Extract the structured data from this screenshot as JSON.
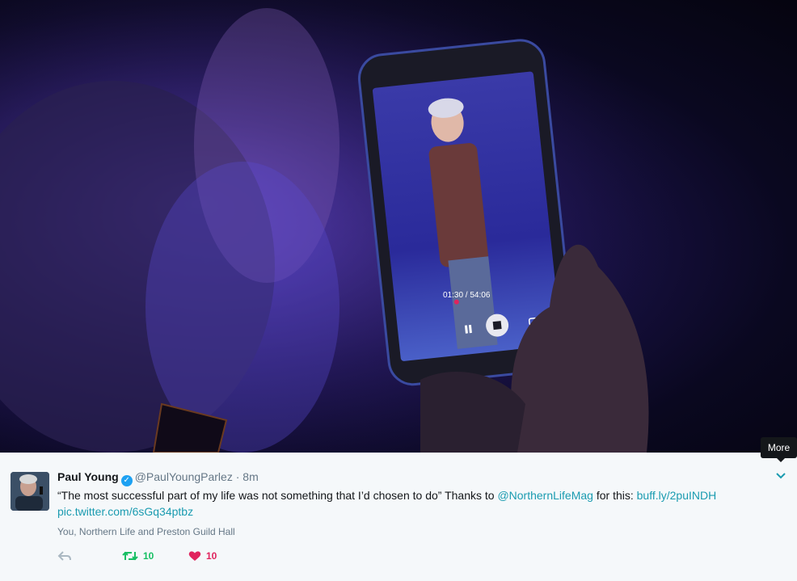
{
  "photo": {
    "alt": "",
    "phone_timer": "01:30 / 54:06"
  },
  "tweet": {
    "author_name": "Paul Young",
    "handle": "@PaulYoungParlez",
    "separator": "·",
    "time": "8m",
    "text_quote": "“The most successful part of my life was not something that I’d chosen to do” Thanks to ",
    "mention": "@NorthernLifeMag",
    "text_mid": " for this: ",
    "short_link": "buff.ly/2puINDH",
    "pic_link": "pic.twitter.com/6sGq34ptbz",
    "context": "You, Northern Life and Preston Guild Hall",
    "retweet_count": "10",
    "like_count": "10"
  },
  "tooltip": {
    "label": "More"
  },
  "colors": {
    "link": "#1a9bb0",
    "retweet": "#17bf63",
    "like": "#e0245e",
    "verified": "#1da1f2"
  }
}
